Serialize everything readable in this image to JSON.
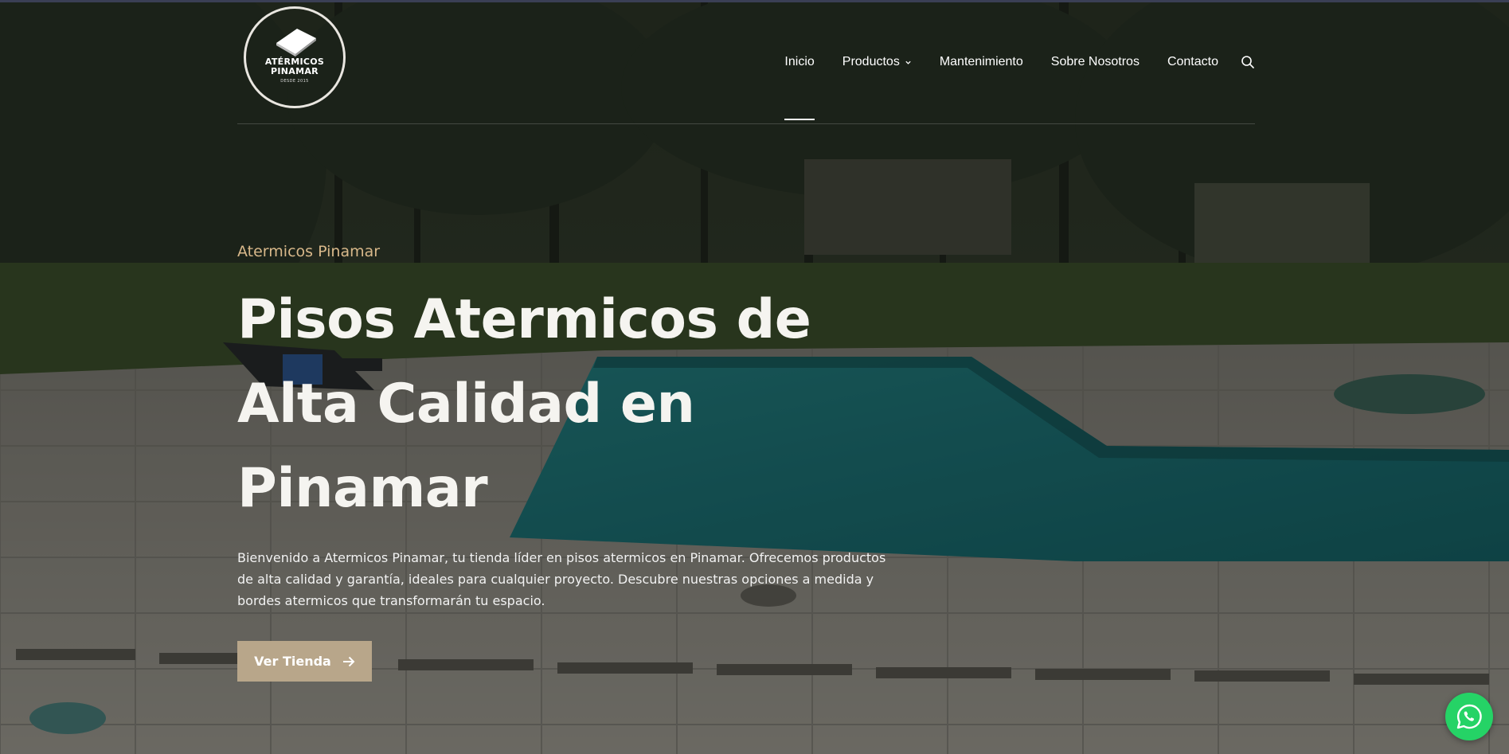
{
  "site": {
    "logo": {
      "line1": "ATÉRMICOS",
      "line2": "PINAMAR",
      "line3": "DESDE 2015"
    }
  },
  "nav": {
    "items": [
      {
        "label": "Inicio",
        "active": true
      },
      {
        "label": "Productos",
        "has_dropdown": true
      },
      {
        "label": "Mantenimiento"
      },
      {
        "label": "Sobre Nosotros"
      },
      {
        "label": "Contacto"
      }
    ],
    "search_icon": "search-icon"
  },
  "hero": {
    "eyebrow": "Atermicos Pinamar",
    "title": "Pisos Atermicos de Alta Calidad en Pinamar",
    "description": "Bienvenido a Atermicos Pinamar, tu tienda líder en pisos atermicos en Pinamar. Ofrecemos productos de alta calidad y garantía, ideales para cualquier proyecto. Descubre nuestras opciones a medida y bordes atermicos que transformarán tu espacio.",
    "button_label": "Ver Tienda",
    "button_icon": "arrow-right-icon"
  },
  "whatsapp": {
    "icon": "whatsapp-icon",
    "color": "#25d366"
  },
  "colors": {
    "accent": "#b8a68a",
    "eyebrow": "#d8b88a"
  }
}
